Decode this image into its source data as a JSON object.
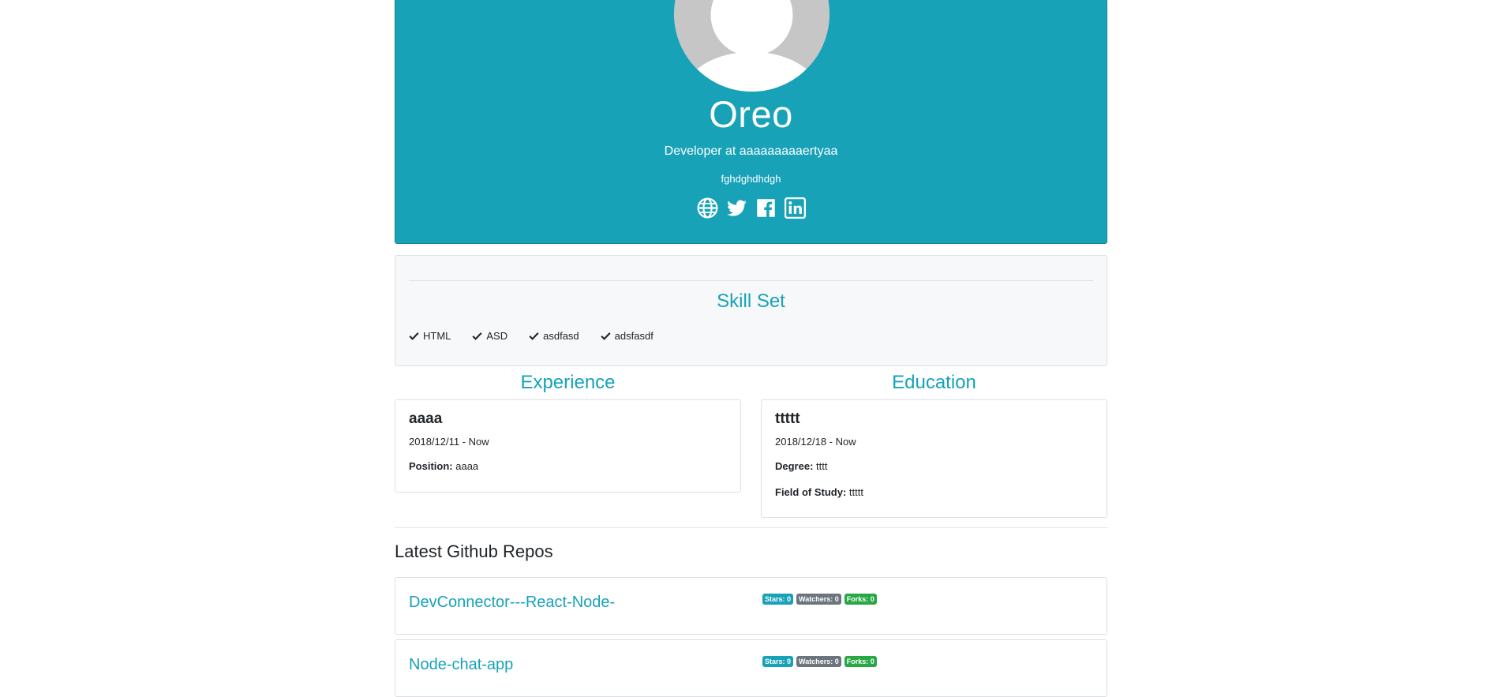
{
  "profile": {
    "name": "Oreo",
    "status": "Developer at aaaaaaaaaertyaa",
    "location": "fghdghdhdgh",
    "social": [
      {
        "icon": "globe-icon"
      },
      {
        "icon": "twitter-icon"
      },
      {
        "icon": "facebook-icon"
      },
      {
        "icon": "linkedin-icon"
      }
    ]
  },
  "skills": {
    "title": "Skill Set",
    "items": [
      "HTML",
      "ASD",
      "asdfasd",
      "adsfasdf"
    ]
  },
  "experience": {
    "title": "Experience",
    "items": [
      {
        "company": "aaaa",
        "dates": "2018/12/11 - Now",
        "position_label": "Position:",
        "position": "aaaa"
      }
    ]
  },
  "education": {
    "title": "Education",
    "items": [
      {
        "school": "ttttt",
        "dates": "2018/12/18 - Now",
        "degree_label": "Degree:",
        "degree": "tttt",
        "field_label": "Field of Study:",
        "field": "ttttt"
      }
    ]
  },
  "repos": {
    "title": "Latest Github Repos",
    "items": [
      {
        "name": "DevConnector---React-Node-",
        "stars": "Stars: 0",
        "watchers": "Watchers: 0",
        "forks": "Forks: 0"
      },
      {
        "name": "Node-chat-app",
        "stars": "Stars: 0",
        "watchers": "Watchers: 0",
        "forks": "Forks: 0"
      }
    ]
  },
  "colors": {
    "brand": "#17a2b8",
    "secondary": "#6c757d",
    "success": "#28a745"
  }
}
